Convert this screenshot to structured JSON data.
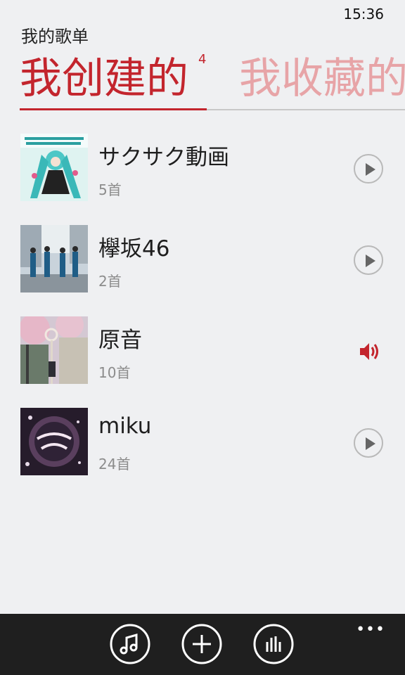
{
  "status": {
    "time": "15:36"
  },
  "header": {
    "title": "我的歌单"
  },
  "pivot": {
    "tabs": [
      {
        "label": "我创建的",
        "count": "4"
      },
      {
        "label": "我收藏的"
      }
    ]
  },
  "playlists": [
    {
      "title": "サクサク動画",
      "count": "5首",
      "action": "play-icon"
    },
    {
      "title": "欅坂46",
      "count": "2首",
      "action": "play-icon"
    },
    {
      "title": "原音",
      "count": "10首",
      "action": "speaker-icon"
    },
    {
      "title": "miku",
      "count": "24首",
      "action": "play-icon"
    }
  ],
  "appbar": {
    "icons": [
      "music-note-icon",
      "plus-icon",
      "equalizer-icon"
    ],
    "more": "•••"
  },
  "colors": {
    "accent": "#c3252d",
    "accent_light": "#e7a4a7",
    "appbar": "#1f1f1f"
  }
}
